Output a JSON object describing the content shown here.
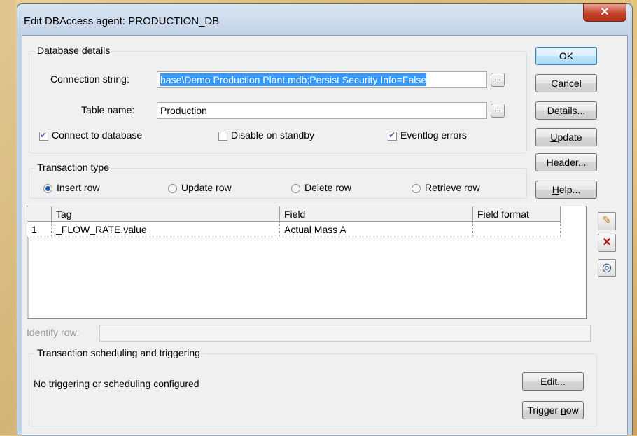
{
  "window": {
    "title": "Edit DBAccess agent: PRODUCTION_DB",
    "close_icon": "close-icon"
  },
  "database_details": {
    "legend": "Database details",
    "connection_label": "Connection string:",
    "connection_value": "base\\Demo Production Plant.mdb;Persist Security Info=False",
    "table_label": "Table name:",
    "table_value": "Production",
    "browse_label": "...",
    "connect_label": "Connect to database",
    "connect_checked": true,
    "disable_label": "Disable on standby",
    "disable_checked": false,
    "eventlog_label": "Eventlog errors",
    "eventlog_checked": true
  },
  "transaction_type": {
    "legend": "Transaction type",
    "options": [
      "Insert row",
      "Update row",
      "Delete row",
      "Retrieve row"
    ],
    "selected": "Insert row"
  },
  "buttons": {
    "ok": "OK",
    "cancel": "Cancel",
    "details": "Details...",
    "update": "Update",
    "header": "Header...",
    "help": "Help..."
  },
  "grid": {
    "columns": [
      "Tag",
      "Field",
      "Field format"
    ],
    "rows": [
      {
        "num": "1",
        "tag": "_FLOW_RATE.value",
        "field": "Actual Mass A",
        "format": ""
      }
    ]
  },
  "side_tools": [
    "new-row-icon",
    "delete-row-icon",
    "gauge-icon"
  ],
  "identify_row": {
    "label": "Identify row:",
    "value": ""
  },
  "scheduling": {
    "legend": "Transaction scheduling and triggering",
    "status": "No triggering or scheduling configured",
    "edit": "Edit...",
    "trigger_now": "Trigger now"
  },
  "colors": {
    "accent": "#3399ff",
    "title_bar": "#c1d2e6",
    "close_button": "#c2432b"
  }
}
